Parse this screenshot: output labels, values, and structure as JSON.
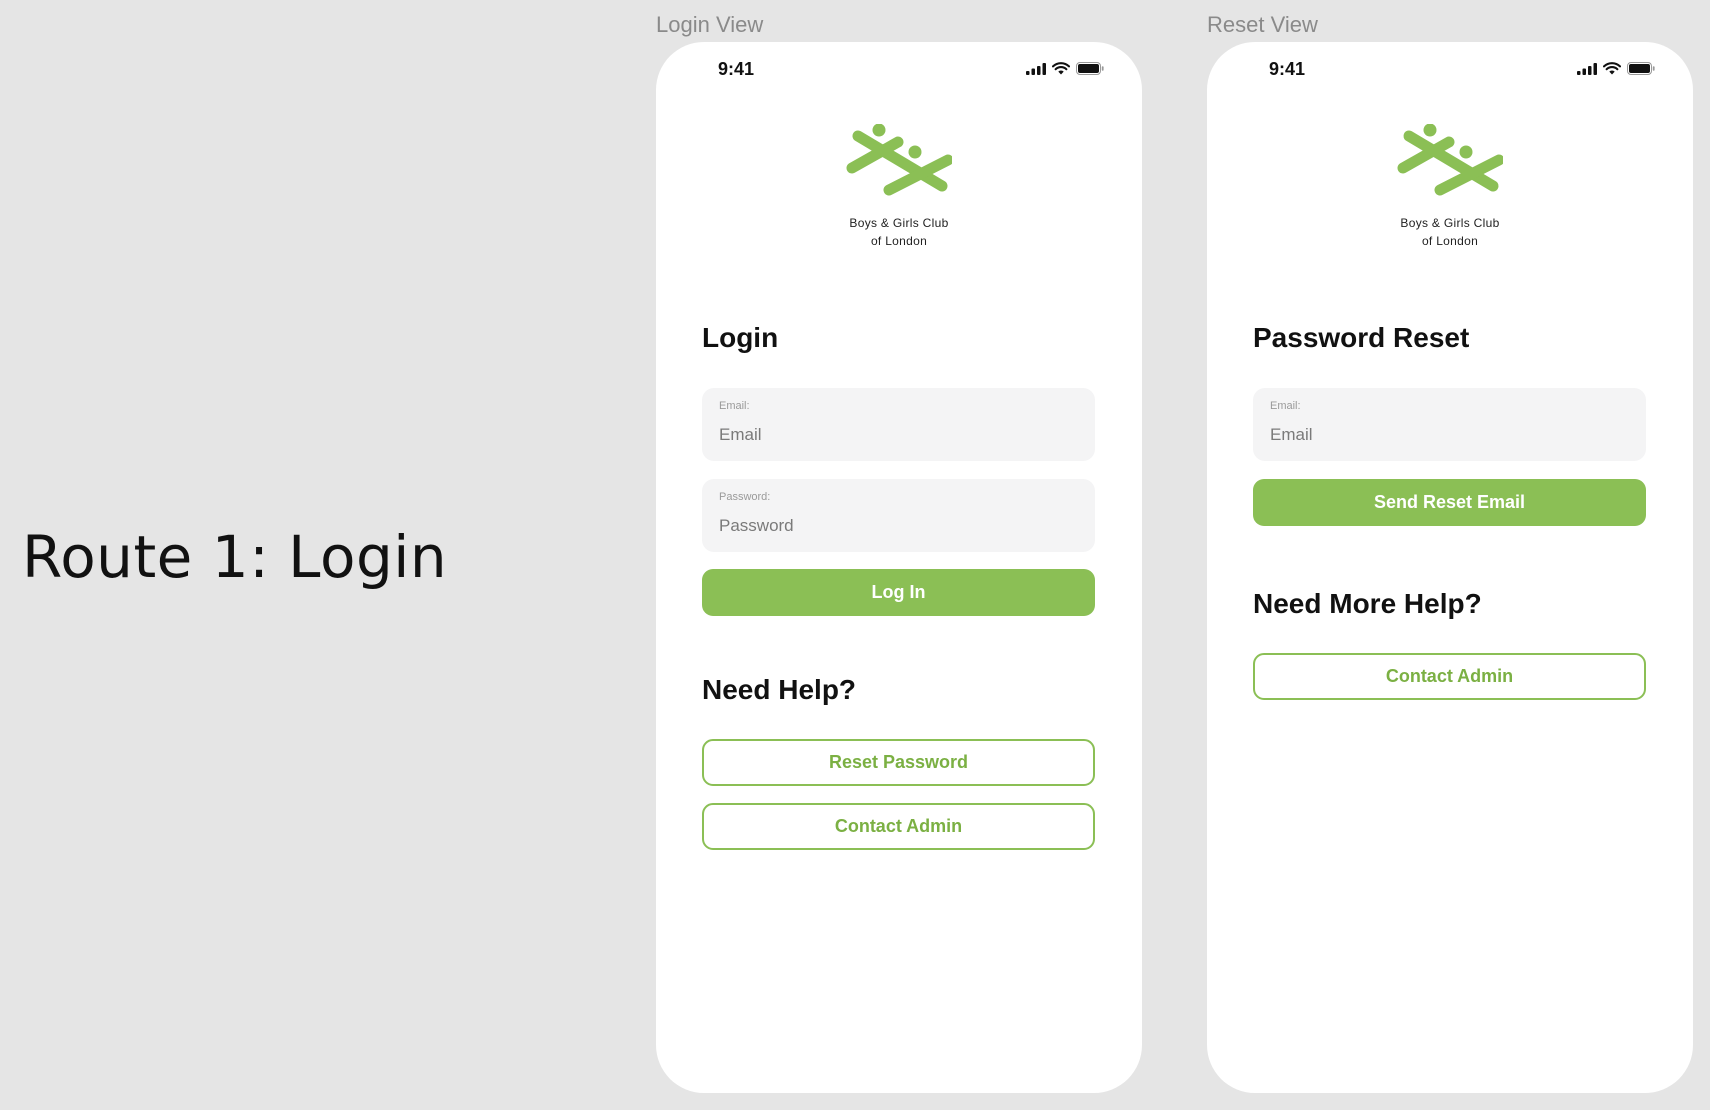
{
  "route_title": "Route 1: Login",
  "brand_color": "#8bbf55",
  "login_view": {
    "frame_label": "Login View",
    "status_time": "9:41",
    "logo_text": "Boys & Girls Club\nof London",
    "heading": "Login",
    "email_label": "Email:",
    "email_placeholder": "Email",
    "password_label": "Password:",
    "password_placeholder": "Password",
    "login_button": "Log In",
    "help_heading": "Need Help?",
    "reset_button": "Reset Password",
    "contact_button": "Contact Admin"
  },
  "reset_view": {
    "frame_label": "Reset View",
    "status_time": "9:41",
    "logo_text": "Boys & Girls Club\nof London",
    "heading": "Password Reset",
    "email_label": "Email:",
    "email_placeholder": "Email",
    "send_button": "Send Reset Email",
    "help_heading": "Need More Help?",
    "contact_button": "Contact Admin"
  }
}
